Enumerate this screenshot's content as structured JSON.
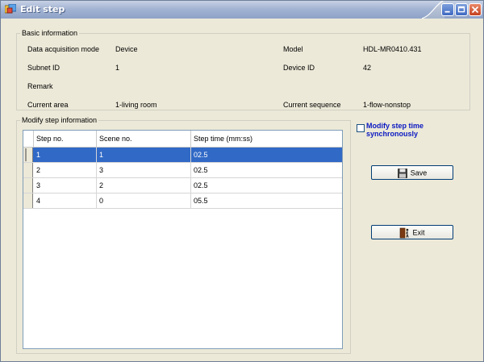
{
  "window": {
    "title": "Edit step"
  },
  "basic_info": {
    "legend": "Basic information",
    "rows": [
      {
        "label": "Data acquisition mode",
        "value": "Device",
        "label2": "Model",
        "value2": "HDL-MR0410.431"
      },
      {
        "label": "Subnet ID",
        "value": "1",
        "label2": "Device ID",
        "value2": "42"
      },
      {
        "label": "Remark",
        "value": "",
        "label2": "",
        "value2": ""
      },
      {
        "label": "Current area",
        "value": "1-living room",
        "label2": "Current sequence",
        "value2": "1-flow-nonstop"
      }
    ]
  },
  "modify": {
    "legend": "Modify step information",
    "columns": [
      "Step no.",
      "Scene no.",
      "Step time (mm:ss)"
    ],
    "rows": [
      {
        "step": "1",
        "scene": "1",
        "time": "02.5",
        "selected": true
      },
      {
        "step": "2",
        "scene": "3",
        "time": "02.5",
        "selected": false
      },
      {
        "step": "3",
        "scene": "2",
        "time": "02.5",
        "selected": false
      },
      {
        "step": "4",
        "scene": "0",
        "time": "05.5",
        "selected": false
      }
    ]
  },
  "options": {
    "sync_label": "Modify step time synchronously",
    "sync_checked": false
  },
  "buttons": {
    "save": "Save",
    "exit": "Exit"
  },
  "colors": {
    "selection": "#3169c6",
    "checkbox_label": "#0a18c2"
  }
}
